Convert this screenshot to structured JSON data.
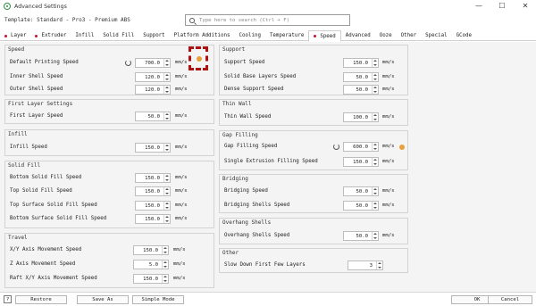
{
  "window": {
    "title": "Advanced Settings",
    "controls": [
      "—",
      "☐",
      "✕"
    ]
  },
  "template": {
    "label": "Template: Standard - Pro3 - Premium ABS",
    "search_placeholder": "Type here to search (Ctrl + F)"
  },
  "tabs": [
    {
      "label": "Layer",
      "modified": true
    },
    {
      "label": "Extruder",
      "modified": true
    },
    {
      "label": "Infill",
      "modified": false
    },
    {
      "label": "Solid Fill",
      "modified": false
    },
    {
      "label": "Support",
      "modified": false
    },
    {
      "label": "Platform Additions",
      "modified": false
    },
    {
      "label": "Cooling",
      "modified": false
    },
    {
      "label": "Temperature",
      "modified": false
    },
    {
      "label": "Speed",
      "modified": true,
      "active": true
    },
    {
      "label": "Advanced",
      "modified": false
    },
    {
      "label": "Ooze",
      "modified": false
    },
    {
      "label": "Other",
      "modified": false
    },
    {
      "label": "Special",
      "modified": false
    },
    {
      "label": "GCode",
      "modified": false
    }
  ],
  "left": {
    "speed": {
      "title": "Speed",
      "rows": [
        {
          "label": "Default Printing Speed",
          "value": "700.0",
          "unit": "mm/s",
          "reset": true
        },
        {
          "label": "Inner Shell Speed",
          "value": "120.0",
          "unit": "mm/s"
        },
        {
          "label": "Outer Shell Speed",
          "value": "120.0",
          "unit": "mm/s"
        }
      ]
    },
    "first_layer": {
      "title": "First Layer Settings",
      "rows": [
        {
          "label": "First Layer Speed",
          "value": "50.0",
          "unit": "mm/s"
        }
      ]
    },
    "infill": {
      "title": "Infill",
      "rows": [
        {
          "label": "Infill Speed",
          "value": "150.0",
          "unit": "mm/s"
        }
      ]
    },
    "solid_fill": {
      "title": "Solid Fill",
      "rows": [
        {
          "label": "Bottom Solid Fill Speed",
          "value": "150.0",
          "unit": "mm/s"
        },
        {
          "label": "Top Solid Fill Speed",
          "value": "150.0",
          "unit": "mm/s"
        },
        {
          "label": "Top Surface Solid Fill Speed",
          "value": "150.0",
          "unit": "mm/s"
        },
        {
          "label": "Bottom Surface Solid Fill Speed",
          "value": "150.0",
          "unit": "mm/s"
        }
      ]
    },
    "travel": {
      "title": "Travel",
      "rows": [
        {
          "label": "X/Y Axis Movement Speed",
          "value": "150.0",
          "unit": "mm/s"
        },
        {
          "label": "Z Axis Movement Speed",
          "value": "5.0",
          "unit": "mm/s"
        },
        {
          "label": "Raft X/Y Axis Movement Speed",
          "value": "150.0",
          "unit": "mm/s"
        }
      ]
    }
  },
  "right": {
    "support": {
      "title": "Support",
      "rows": [
        {
          "label": "Support Speed",
          "value": "150.0",
          "unit": "mm/s"
        },
        {
          "label": "Solid Base Layers Speed",
          "value": "50.0",
          "unit": "mm/s"
        },
        {
          "label": "Dense Support Speed",
          "value": "50.0",
          "unit": "mm/s"
        }
      ]
    },
    "thin_wall": {
      "title": "Thin Wall",
      "rows": [
        {
          "label": "Thin Wall Speed",
          "value": "100.0",
          "unit": "mm/s"
        }
      ]
    },
    "gap_filling": {
      "title": "Gap Filling",
      "rows": [
        {
          "label": "Gap Filling Speed",
          "value": "600.0",
          "unit": "mm/s",
          "reset": true,
          "warning": true
        },
        {
          "label": "Single Extrusion Filling Speed",
          "value": "150.0",
          "unit": "mm/s"
        }
      ]
    },
    "bridging": {
      "title": "Bridging",
      "rows": [
        {
          "label": "Bridging Speed",
          "value": "50.0",
          "unit": "mm/s"
        },
        {
          "label": "Bridging Shells Speed",
          "value": "50.0",
          "unit": "mm/s"
        }
      ]
    },
    "overhang": {
      "title": "Overhang Shells",
      "rows": [
        {
          "label": "Overhang Shells Speed",
          "value": "50.0",
          "unit": "mm/s"
        }
      ]
    },
    "other": {
      "title": "Other",
      "rows": [
        {
          "label": "Slow Down First Few Layers",
          "value": "3",
          "unit": ""
        }
      ]
    }
  },
  "footer": {
    "help": "?",
    "restore": "Restore",
    "save_as": "Save As",
    "simple_mode": "Simple Mode",
    "ok": "OK",
    "cancel": "Cancel"
  },
  "colors": {
    "modified_dot": "#c8102e",
    "warning": "#e8a13a",
    "highlight": "#b01010"
  }
}
